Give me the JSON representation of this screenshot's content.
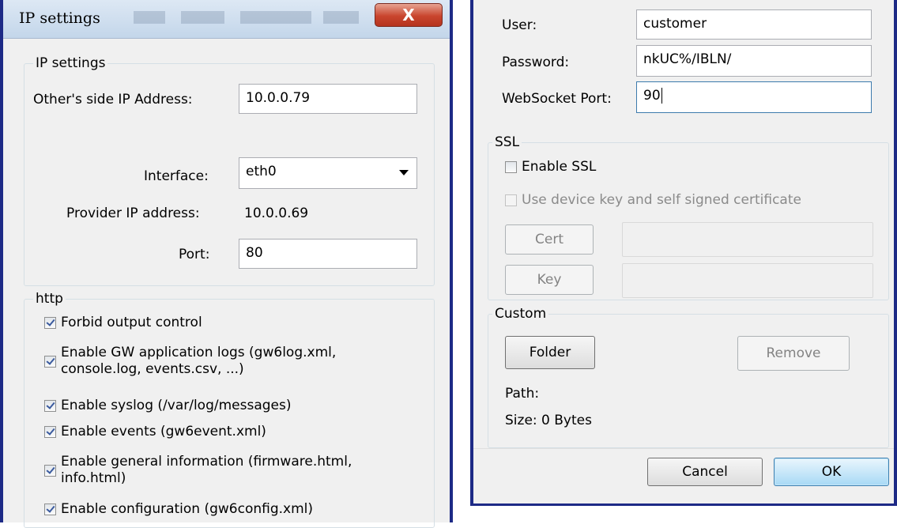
{
  "left_dialog": {
    "window_title": "IP settings",
    "close_glyph": "X",
    "ip_group": {
      "label": "IP settings",
      "other_ip_label": "Other's side IP Address:",
      "other_ip_value": "10.0.0.79",
      "interface_label": "Interface:",
      "interface_value": "eth0",
      "provider_ip_label": "Provider IP address:",
      "provider_ip_value": "10.0.0.69",
      "port_label": "Port:",
      "port_value": "80"
    },
    "http_group": {
      "label": "http",
      "options": [
        {
          "label": "Forbid output control",
          "checked": true
        },
        {
          "label": "Enable GW application logs (gw6log.xml,\nconsole.log, events.csv, ...)",
          "checked": true
        },
        {
          "label": "Enable syslog (/var/log/messages)",
          "checked": true
        },
        {
          "label": "Enable events (gw6event.xml)",
          "checked": true
        },
        {
          "label": "Enable general information (firmware.html,\ninfo.html)",
          "checked": true
        },
        {
          "label": "Enable configuration (gw6config.xml)",
          "checked": true
        }
      ]
    }
  },
  "right_dialog": {
    "user_label": "User:",
    "user_value": "customer",
    "password_label": "Password:",
    "password_value": "nkUC%/IBLN/",
    "websocket_port_label": "WebSocket Port:",
    "websocket_port_value": "90",
    "ssl_group": {
      "label": "SSL",
      "enable_ssl_label": "Enable SSL",
      "enable_ssl_checked": false,
      "use_device_key_label": "Use device key and self signed certificate",
      "use_device_key_checked": false,
      "cert_button": "Cert",
      "key_button": "Key"
    },
    "custom_group": {
      "label": "Custom",
      "folder_button": "Folder",
      "remove_button": "Remove",
      "path_label": "Path:",
      "size_label": "Size: 0 Bytes"
    },
    "cancel_button": "Cancel",
    "ok_button": "OK"
  }
}
